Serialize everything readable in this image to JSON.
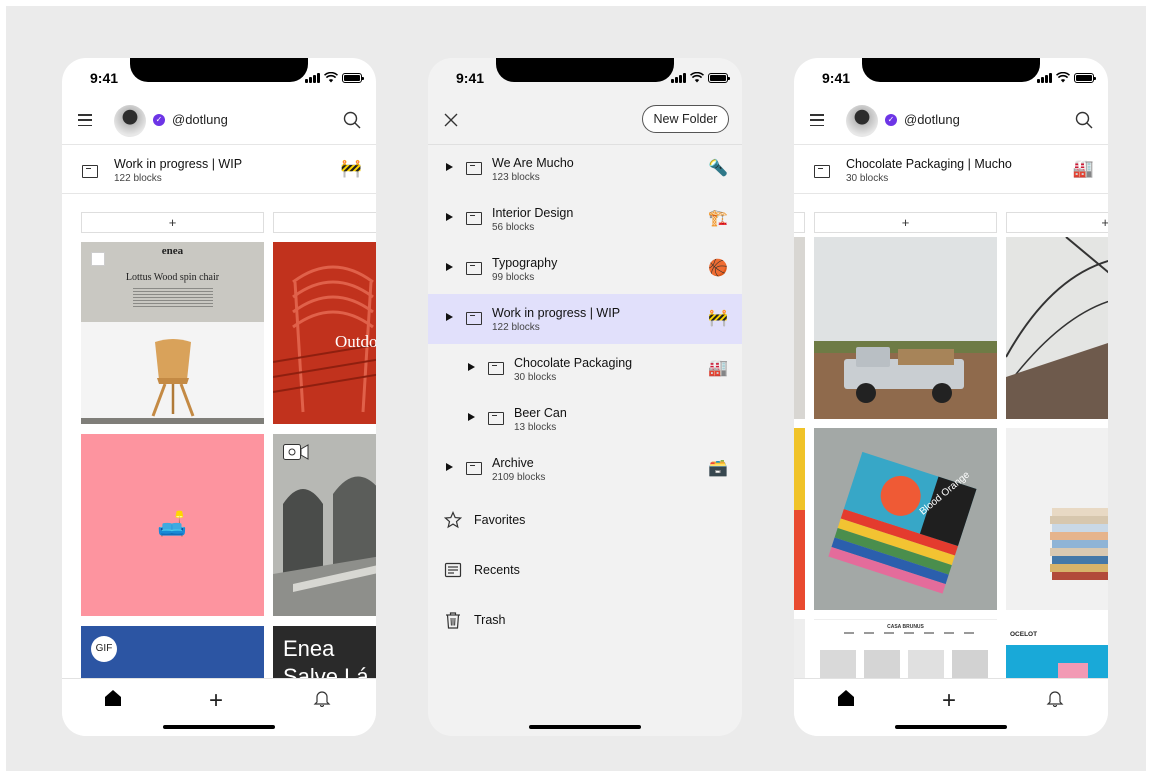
{
  "phone1": {
    "time": "9:41",
    "handle": "@dotlung",
    "channel": {
      "title": "Work in progress | WIP",
      "count": "122 blocks",
      "emoji": "🚧"
    },
    "add_label": "+",
    "blocks": {
      "enea_logo": "enea",
      "enea_heading": "Lottus Wood spin chair",
      "outdoor_text": "Outdo",
      "pink_emoji": "🛋️",
      "gif_badge": "GIF",
      "dark_text_1": "Enea",
      "dark_text_2": "Salve Lá"
    }
  },
  "phone2": {
    "time": "9:41",
    "new_folder_label": "New Folder",
    "folders": [
      {
        "title": "We Are Mucho",
        "count": "123 blocks",
        "emoji": "🔦"
      },
      {
        "title": "Interior Design",
        "count": "56 blocks",
        "emoji": "🏗️"
      },
      {
        "title": "Typography",
        "count": "99 blocks",
        "emoji": "🏀"
      },
      {
        "title": "Work in progress | WIP",
        "count": "122 blocks",
        "emoji": "🚧"
      },
      {
        "title": "Chocolate Packaging",
        "count": "30 blocks",
        "emoji": "🏭"
      },
      {
        "title": "Beer Can",
        "count": "13 blocks",
        "emoji": ""
      },
      {
        "title": "Archive",
        "count": "2109 blocks",
        "emoji": "🗃️"
      }
    ],
    "menu": {
      "favorites": "Favorites",
      "recents": "Recents",
      "trash": "Trash"
    }
  },
  "phone3": {
    "time": "9:41",
    "handle": "@dotlung",
    "channel": {
      "title": "Chocolate Packaging | Mucho",
      "count": "30 blocks",
      "emoji": "🏭"
    },
    "add_label": "+",
    "blocks": {
      "book_title": "Blood Orange",
      "casa_header": "CASA BRUNUS",
      "ocelot_header": "OCELOT"
    }
  },
  "colors": {
    "background": "#ebebeb",
    "active_row": "#e1e0fb",
    "verified": "#6d35e6",
    "pink_tile": "#fd949f"
  },
  "icons": [
    "hamburger-icon",
    "search-icon",
    "folder-icon",
    "close-icon",
    "home-icon",
    "plus-icon",
    "bell-icon",
    "star-icon",
    "recents-icon",
    "trash-icon",
    "verified-icon"
  ]
}
